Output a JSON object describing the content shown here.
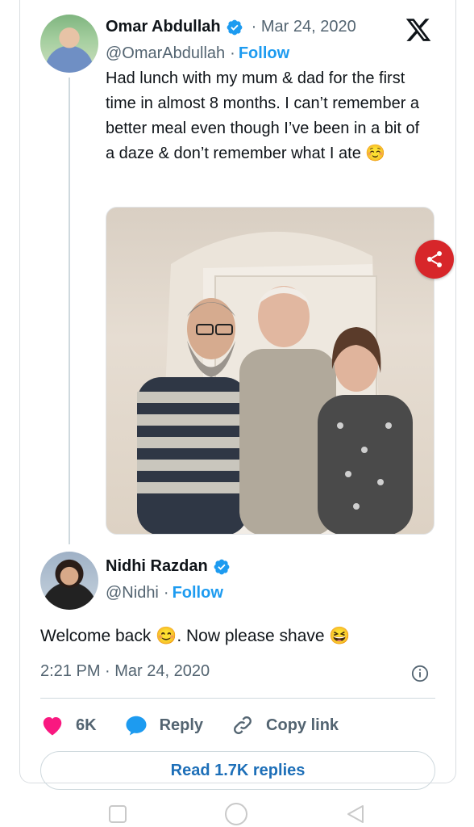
{
  "tweet": {
    "author_name": "Omar Abdullah",
    "date_sep": "·",
    "date": "Mar 24, 2020",
    "handle": "@OmarAbdullah",
    "follow_sep": "·",
    "follow_label": "Follow",
    "text": "Had lunch with my mum & dad for the first time in almost 8 months. I can’t remember a better meal even though I’ve been in a bit of a daze & don’t remember what I ate ☺️",
    "photo_icon": "photo-image",
    "share_icon": "share-icon"
  },
  "reply": {
    "author_name": "Nidhi Razdan",
    "handle": "@Nidhi",
    "follow_sep": "·",
    "follow_label": "Follow",
    "text": "Welcome back 😊. Now please shave 😆",
    "timestamp": "2:21 PM · Mar 24, 2020"
  },
  "actions": {
    "like_count": "6K",
    "reply_label": "Reply",
    "copy_label": "Copy link"
  },
  "read_replies_label": "Read 1.7K replies",
  "colors": {
    "brand_blue": "#1d9bf0",
    "like_pink": "#f91880",
    "share_red": "#d7262a"
  },
  "navbar": {
    "recent_icon": "square-icon",
    "home_icon": "circle-icon",
    "back_icon": "triangle-back-icon"
  }
}
